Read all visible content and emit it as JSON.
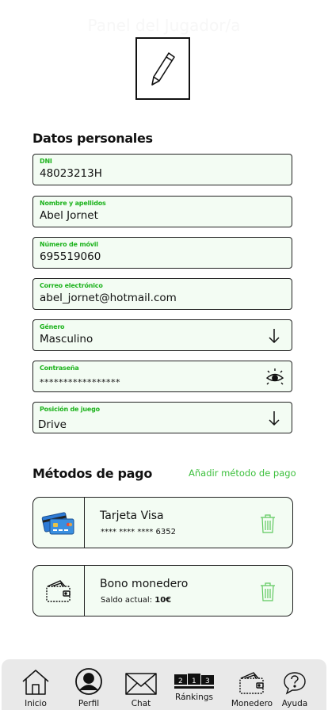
{
  "header": {
    "title": "Panel del Jugador/a"
  },
  "personal": {
    "title": "Datos personales",
    "fields": [
      {
        "label": "DNI",
        "value": "48023213H"
      },
      {
        "label": "Nombre y apellidos",
        "value": "Abel Jornet"
      },
      {
        "label": "Número de móvil",
        "value": "695519060"
      },
      {
        "label": "Correo electrónico",
        "value": "abel_jornet@hotmail.com"
      },
      {
        "label": "Género",
        "value": "Masculino"
      },
      {
        "label": "Contraseña",
        "value": "*****************"
      },
      {
        "label": "Posición de juego",
        "value": "Drive"
      }
    ]
  },
  "payment": {
    "title": "Métodos de pago",
    "add_label": "Añadir método de pago",
    "methods": [
      {
        "name": "Tarjeta Visa",
        "detail": "**** **** **** 6352"
      },
      {
        "name": "Bono monedero",
        "detail_prefix": "Saldo actual: ",
        "detail_value": "10€"
      }
    ]
  },
  "nav": {
    "items": [
      {
        "label": "Inicio",
        "icon": "home-icon"
      },
      {
        "label": "Perfil",
        "icon": "user-icon"
      },
      {
        "label": "Chat",
        "icon": "envelope-icon"
      },
      {
        "label": "Ránkings",
        "icon": "podium-icon"
      },
      {
        "label": "Monedero",
        "icon": "wallet-icon"
      },
      {
        "label": "Ayuda",
        "icon": "help-icon"
      }
    ],
    "podium": [
      "2",
      "1",
      "3"
    ]
  },
  "colors": {
    "accent": "#1db31d",
    "field_bg": "#f3fcf3",
    "nav_bg": "#e9e9e9"
  }
}
